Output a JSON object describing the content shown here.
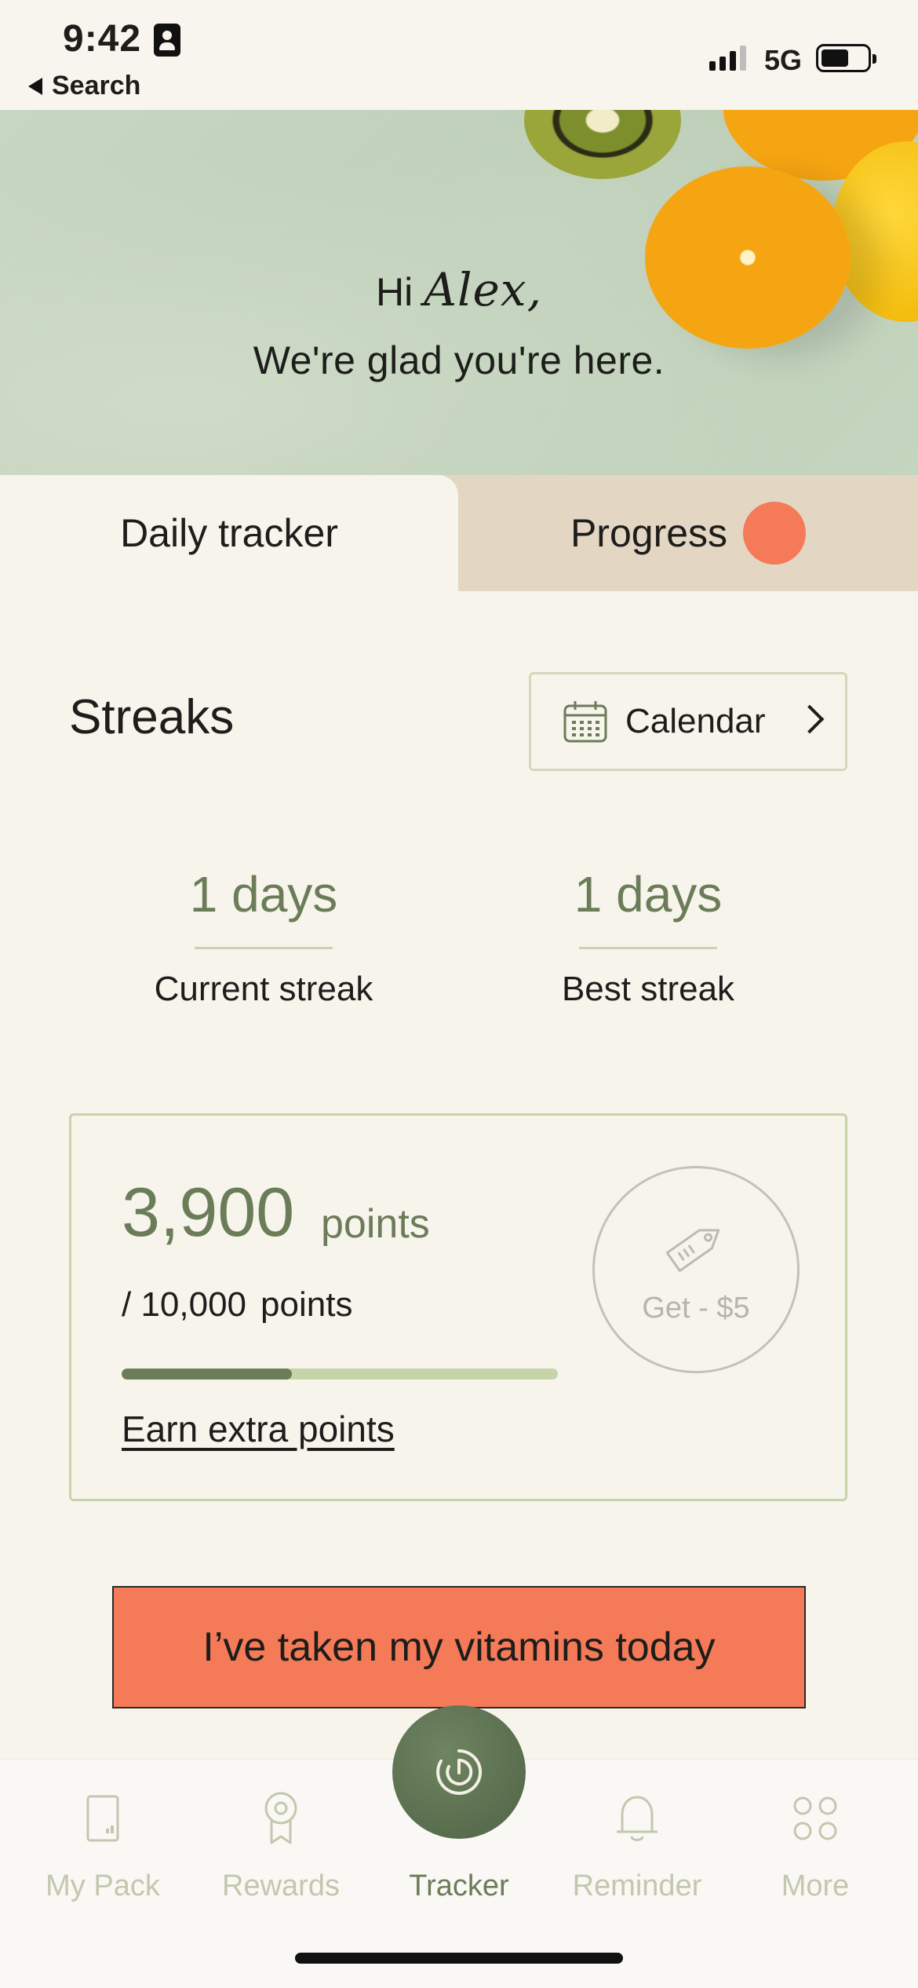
{
  "status_bar": {
    "time": "9:42",
    "back_label": "Search",
    "network": "5G"
  },
  "hero": {
    "greeting_prefix": "Hi",
    "user_name": "Alex,",
    "subtitle": "We're glad you're here."
  },
  "tabs": {
    "daily_tracker": "Daily tracker",
    "progress": "Progress"
  },
  "streaks": {
    "title": "Streaks",
    "calendar_label": "Calendar",
    "current_value": "1 days",
    "current_label": "Current streak",
    "best_value": "1 days",
    "best_label": "Best streak"
  },
  "points": {
    "value": "3,900",
    "unit": "points",
    "goal": "/ 10,000",
    "goal_unit": "points",
    "progress_fraction": 0.39,
    "earn_link": "Earn extra points",
    "reward_label": "Get - $5"
  },
  "cta": {
    "label": "I’ve taken my vitamins today"
  },
  "bottom_nav": {
    "items": [
      {
        "label": "My Pack",
        "icon": "phone-pack-icon"
      },
      {
        "label": "Rewards",
        "icon": "award-ribbon-icon"
      },
      {
        "label": "Tracker",
        "icon": "tracker-icon"
      },
      {
        "label": "Reminder",
        "icon": "bell-icon"
      },
      {
        "label": "More",
        "icon": "four-circles-icon"
      }
    ],
    "active": "Tracker"
  },
  "colors": {
    "accent": "#f47a58",
    "sage": "#6b7c59",
    "light_sage": "#c6d4a9",
    "background": "#f7f4ec",
    "tab_inactive": "#e3d6c3"
  }
}
